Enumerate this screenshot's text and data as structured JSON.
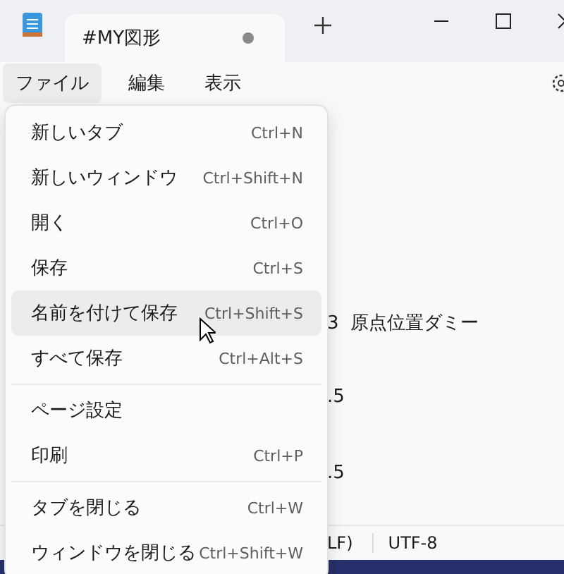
{
  "tab": {
    "title": "#MY図形",
    "modified": true
  },
  "menubar": [
    {
      "label": "ファイル",
      "selected": true
    },
    {
      "label": "編集",
      "selected": false
    },
    {
      "label": "表示",
      "selected": false
    }
  ],
  "editor_lines": [
    "3  原点位置ダミー",
    ".5",
    ".5"
  ],
  "status_bar": [
    "LF)",
    "UTF-8"
  ],
  "file_menu": {
    "groups": [
      [
        {
          "label": "新しいタブ",
          "shortcut": "Ctrl+N",
          "selected": false
        },
        {
          "label": "新しいウィンドウ",
          "shortcut": "Ctrl+Shift+N",
          "selected": false
        },
        {
          "label": "開く",
          "shortcut": "Ctrl+O",
          "selected": false
        },
        {
          "label": "保存",
          "shortcut": "Ctrl+S",
          "selected": false
        },
        {
          "label": "名前を付けて保存",
          "shortcut": "Ctrl+Shift+S",
          "selected": true
        },
        {
          "label": "すべて保存",
          "shortcut": "Ctrl+Alt+S",
          "selected": false
        }
      ],
      [
        {
          "label": "ページ設定",
          "selected": false
        },
        {
          "label": "印刷",
          "shortcut": "Ctrl+P",
          "selected": false
        }
      ],
      [
        {
          "label": "タブを閉じる",
          "shortcut": "Ctrl+W",
          "selected": false
        },
        {
          "label": "ウィンドウを閉じる",
          "shortcut": "Ctrl+Shift+W",
          "selected": false
        }
      ]
    ]
  }
}
